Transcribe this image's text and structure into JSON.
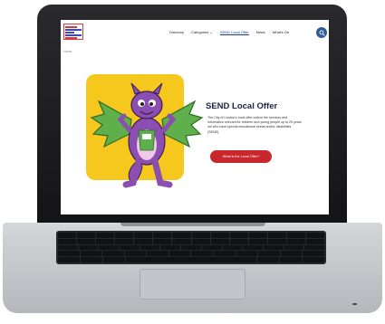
{
  "nav": {
    "items": [
      "Directory",
      "Categories",
      "SEND Local Offer",
      "News",
      "What's On"
    ],
    "active_index": 2,
    "categories_chevron": "chevron-down-icon",
    "search_icon": "search-icon"
  },
  "breadcrumb": "Home",
  "hero": {
    "title": "SEND Local Offer",
    "text": "The City of London's local offer outline the services and information relevant for children and young people up to 25 years old who have special educational needs and/or disabilities (SEND).",
    "cta_label": "What is the Local Offer?"
  },
  "colors": {
    "accent_blue": "#1b3f8f",
    "search_button": "#2f5d9b",
    "cta_red": "#c8282c",
    "hero_yellow": "#f6c71d",
    "dragon_purple": "#8a4fb0",
    "dragon_wings": "#5fb04c"
  }
}
